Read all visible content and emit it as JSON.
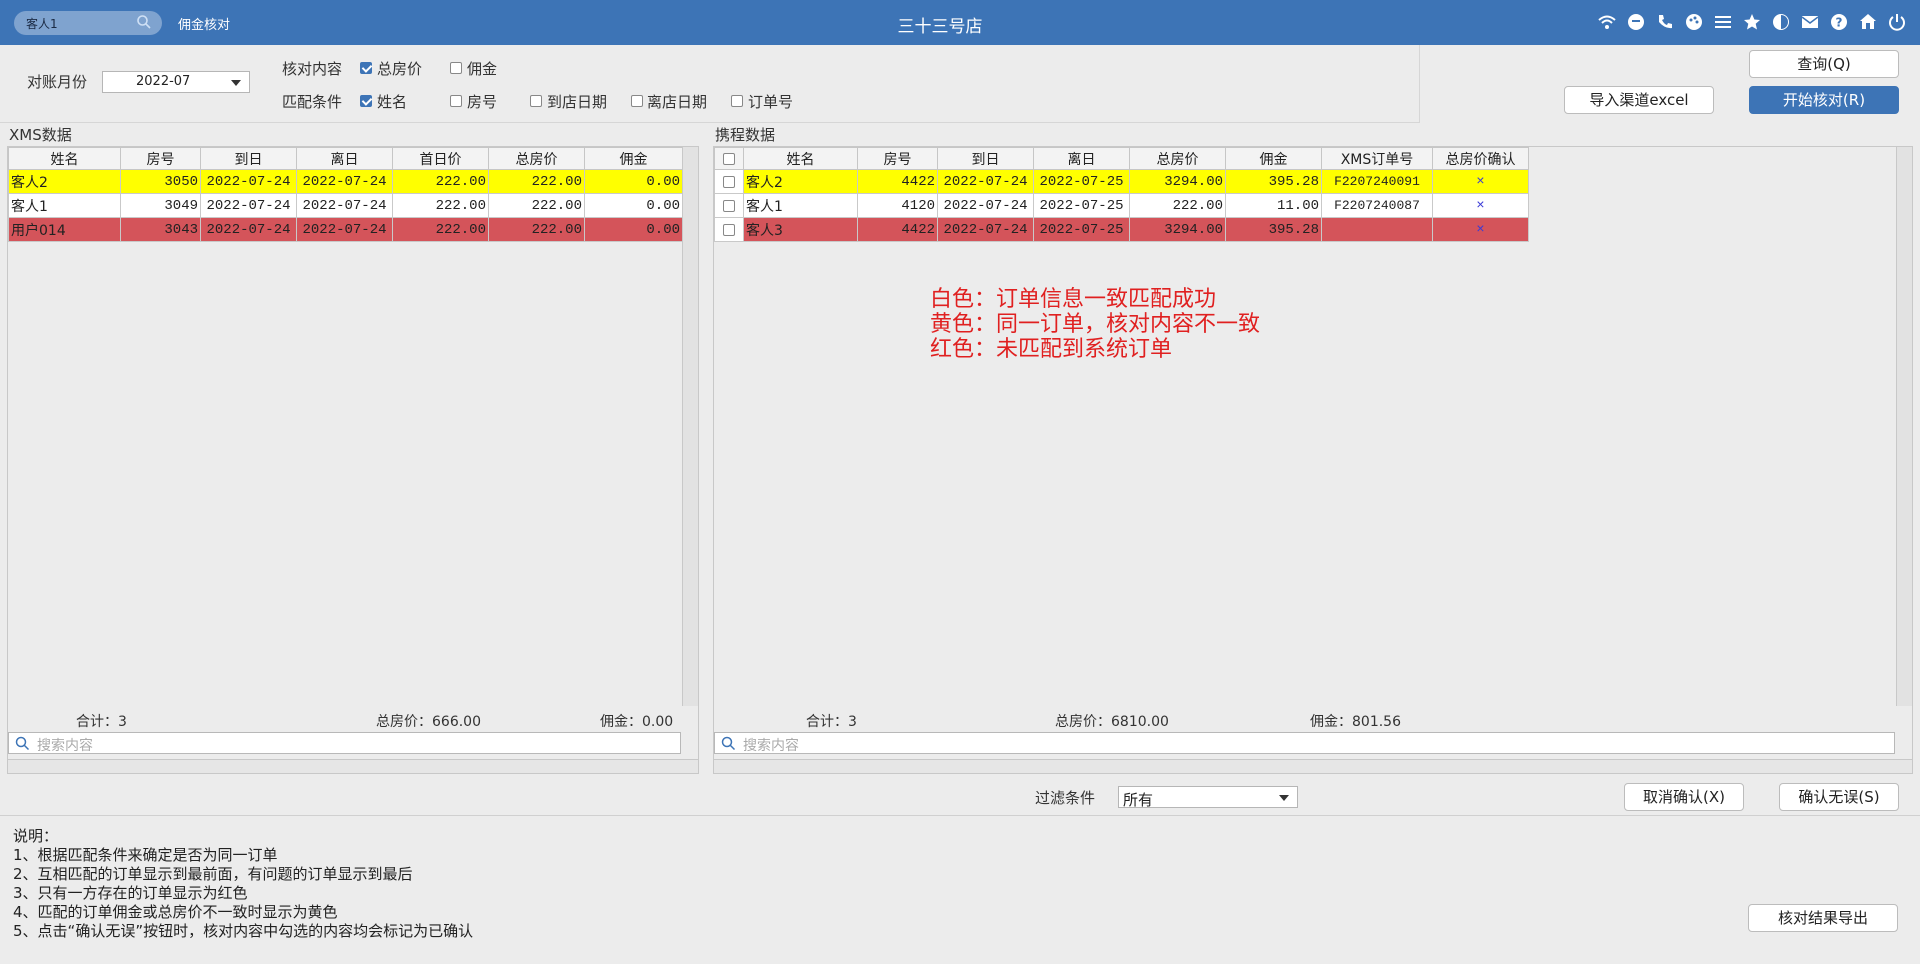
{
  "titlebar": {
    "search_value": "客人1",
    "app_name": "佣金核对",
    "store_name": "三十三号店",
    "icons": [
      "wifi-icon",
      "chat-icon",
      "phone-icon",
      "palette-icon",
      "menu-icon",
      "star-icon",
      "theme-icon",
      "mail-icon",
      "help-icon",
      "home-icon",
      "power-icon"
    ]
  },
  "form": {
    "month_label": "对账月份",
    "month_value": "2022-07",
    "check_label": "核对内容",
    "check_opts": [
      {
        "label": "总房价",
        "checked": true
      },
      {
        "label": "佣金",
        "checked": false
      }
    ],
    "match_label": "匹配条件",
    "match_opts": [
      {
        "label": "姓名",
        "checked": true
      },
      {
        "label": "房号",
        "checked": false
      },
      {
        "label": "到店日期",
        "checked": false
      },
      {
        "label": "离店日期",
        "checked": false
      },
      {
        "label": "订单号",
        "checked": false
      }
    ],
    "query_btn": "查询(Q)",
    "import_btn": "导入渠道excel",
    "start_btn": "开始核对(R)"
  },
  "xms": {
    "title": "XMS数据",
    "columns": [
      "姓名",
      "房号",
      "到日",
      "离日",
      "首日价",
      "总房价",
      "佣金"
    ],
    "rows": [
      {
        "color": "yellow",
        "cells": [
          "客人2",
          "3050",
          "2022-07-24",
          "2022-07-24",
          "222.00",
          "222.00",
          "0.00"
        ]
      },
      {
        "color": "white",
        "cells": [
          "客人1",
          "3049",
          "2022-07-24",
          "2022-07-24",
          "222.00",
          "222.00",
          "0.00"
        ]
      },
      {
        "color": "red",
        "cells": [
          "用户014",
          "3043",
          "2022-07-24",
          "2022-07-24",
          "222.00",
          "222.00",
          "0.00"
        ]
      }
    ],
    "total_count": "合计：3",
    "total_price": "总房价：666.00",
    "total_comm": "佣金：0.00",
    "search_placeholder": "搜索内容"
  },
  "ctrip": {
    "title": "携程数据",
    "columns": [
      "",
      "姓名",
      "房号",
      "到日",
      "离日",
      "总房价",
      "佣金",
      "XMS订单号",
      "总房价确认"
    ],
    "rows": [
      {
        "color": "yellow",
        "cells": [
          "",
          "客人2",
          "4422",
          "2022-07-24",
          "2022-07-25",
          "3294.00",
          "395.28",
          "F2207240091",
          "×"
        ]
      },
      {
        "color": "white",
        "cells": [
          "",
          "客人1",
          "4120",
          "2022-07-24",
          "2022-07-25",
          "222.00",
          "11.00",
          "F2207240087",
          "×"
        ]
      },
      {
        "color": "red",
        "cells": [
          "",
          "客人3",
          "4422",
          "2022-07-24",
          "2022-07-25",
          "3294.00",
          "395.28",
          "",
          "×"
        ]
      }
    ],
    "total_count": "合计：3",
    "total_price": "总房价：6810.00",
    "total_comm": "佣金：801.56",
    "search_placeholder": "搜索内容"
  },
  "legend": [
    "白色：订单信息一致匹配成功",
    "黄色：同一订单，核对内容不一致",
    "红色：未匹配到系统订单"
  ],
  "filter": {
    "label": "过滤条件",
    "value": "所有"
  },
  "actions": {
    "cancel_btn": "取消确认(X)",
    "confirm_btn": "确认无误(S)",
    "export_btn": "核对结果导出"
  },
  "notes": [
    "说明：",
    "1、根据匹配条件来确定是否为同一订单",
    "2、互相匹配的订单显示到最前面，有问题的订单显示到最后",
    "3、只有一方存在的订单显示为红色",
    "4、匹配的订单佣金或总房价不一致时显示为黄色",
    "5、点击“确认无误”按钮时，核对内容中勾选的内容均会标记为已确认"
  ],
  "colors": {
    "titlebar": "#3d74b6",
    "yellow_row": "#ffff00",
    "red_row": "#d4545a",
    "legend_text": "#e02020"
  }
}
